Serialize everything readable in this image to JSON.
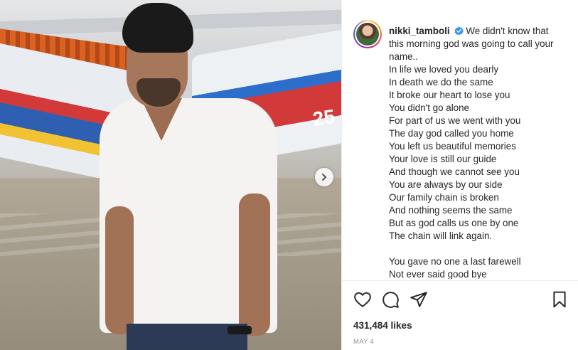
{
  "post": {
    "username": "nikki_tamboli",
    "verified": true,
    "caption_lines": [
      "We didn't know that",
      "this morning god was going to call your",
      "name..",
      "In life we loved you dearly",
      "In death we do the same",
      "It broke our heart to lose you",
      "You didn't go alone",
      "For part of us we went with you",
      "The day god called you home",
      "You left us beautiful memories",
      "Your love is still our guide",
      "And though we cannot see you",
      "You are always by our side",
      "Our family chain is broken",
      "And nothing seems the same",
      "But as god calls us one by one",
      "The chain will link again.",
      "",
      "You gave no one a last farewell",
      "Not ever said good bye"
    ],
    "likes": "431,484 likes",
    "date": "MAY 4",
    "boat_number": "25"
  },
  "icons": {
    "like": "heart-icon",
    "comment": "comment-icon",
    "share": "paper-plane-icon",
    "save": "bookmark-icon",
    "next": "chevron-right-icon",
    "verified": "verified-badge-icon"
  },
  "colors": {
    "verified_blue": "#3897f0",
    "text": "#262626",
    "muted": "#8e8e8e"
  }
}
